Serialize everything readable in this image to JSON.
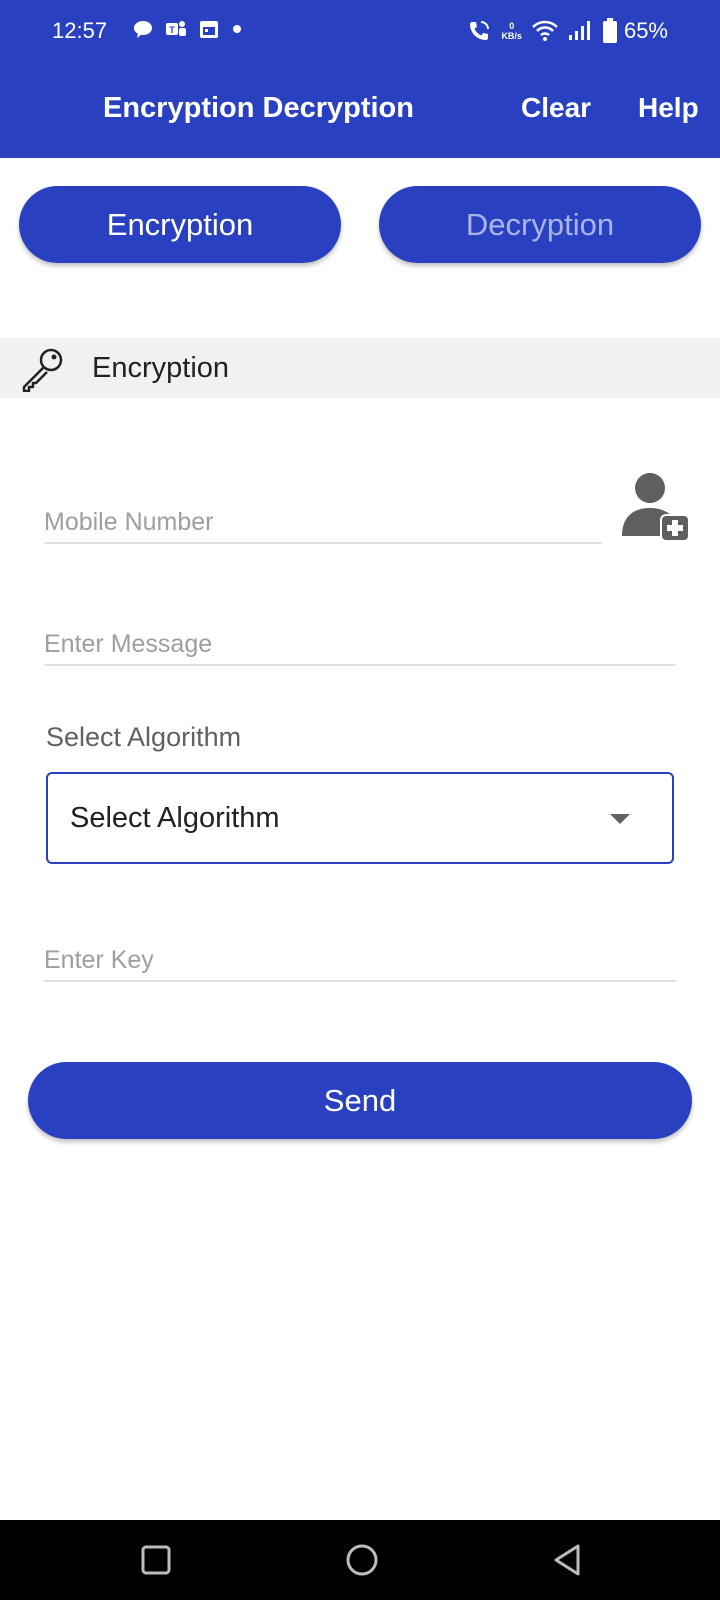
{
  "status_bar": {
    "time": "12:57",
    "net_speed_value": "0",
    "net_speed_unit": "KB/s",
    "battery": "65%",
    "icons": [
      "chat-bubble-icon",
      "teams-icon",
      "calendar-icon",
      "dot-icon",
      "wifi-call-icon",
      "wifi-icon",
      "signal-icon",
      "battery-icon"
    ]
  },
  "app_bar": {
    "title": "Encryption Decryption",
    "clear_label": "Clear",
    "help_label": "Help",
    "color": "#2941c0"
  },
  "tabs": {
    "encryption": "Encryption",
    "decryption": "Decryption",
    "active": "Encryption"
  },
  "section": {
    "title": "Encryption",
    "icon": "key-icon"
  },
  "form": {
    "mobile_placeholder": "Mobile Number",
    "message_placeholder": "Enter Message",
    "algorithm_label": "Select Algorithm",
    "algorithm_selected": "Select Algorithm",
    "key_placeholder": "Enter Key",
    "send_label": "Send"
  },
  "nav_bar": {
    "buttons": [
      "recent-apps-icon",
      "home-icon",
      "back-icon"
    ]
  }
}
